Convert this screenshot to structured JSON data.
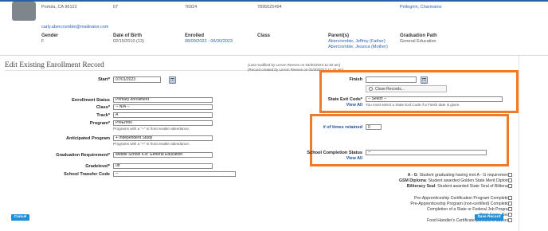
{
  "header": {
    "address": "Portola, CA 96122",
    "grade": "07",
    "school_id": "76924",
    "state_student_id": "7895625494",
    "staff_name": "Pellegrini, Charmaine",
    "email": "carly.abercrombie@mailinator.com",
    "labels": {
      "gender": "Gender",
      "dob": "Date of Birth",
      "enrolled": "Enrolled",
      "class": "Class",
      "parents": "Parent(s)",
      "graduation_path": "Graduation Path"
    },
    "gender": "F",
    "dob": "02/15/2010 (13)",
    "enrolled": "08/09/2022 - 06/30/2023",
    "parents": [
      "Abercrombie, Jeffrey (Father)",
      "Abercrombie, Jessica (Mother)"
    ],
    "graduation_path": "General Education"
  },
  "form": {
    "title": "Edit Existing Enrollment Record",
    "modified_note": "(Last modified by LeAnn Reeves on 03/30/2023 11:20 am)",
    "created_note": "(Record created by LeAnn Reeves on 03/30/2023 11:20 am)",
    "start_label": "Start*",
    "start_value": "07/01/2023",
    "enrollment_status_label": "Enrollment Status",
    "enrollment_status_value": "Primary enrollment",
    "class_label": "Class*",
    "class_value": "-- N/A --",
    "track_label": "Track*",
    "track_value": "A",
    "program_label": "Program*",
    "program_value": "PreEnroll",
    "program_help": "Programs with a \"+\" in front enable attendance.",
    "anticipated_program_label": "Anticipated Program",
    "anticipated_program_value": "+ Independent Study",
    "anticipated_program_help": "Programs with a \"+\" in front enable attendance.",
    "graduation_requirement_label": "Graduation Requirement*",
    "graduation_requirement_value": "Middle School 6-8: General Education",
    "gradelevel_label": "Gradelevel*",
    "gradelevel_value": "08",
    "school_transfer_label": "School Transfer Code",
    "school_transfer_value": "--",
    "finish_label": "Finish",
    "close_records_label": "Close Records...",
    "state_exit_label": "State Exit Code*",
    "state_exit_value": "-- Select --",
    "state_exit_help": "You must select a State Exit Code if a Finish date is given.",
    "view_all": "View All",
    "times_retained_label": "# of times retained",
    "times_retained_value": "0",
    "school_completion_label": "School Completion Status",
    "school_completion_value": "--",
    "view_all_2": "View All"
  },
  "checkboxes": [
    {
      "bold": "A - G",
      "text": ": Student graduating having met A - G requirements"
    },
    {
      "bold": "GSM Diploma",
      "text": ": Student awarded Golden State Merit Diploma"
    },
    {
      "bold": "Biliteracy Seal",
      "text": ": Student awarded State Seal of Biliteracy"
    },
    {
      "bold": "",
      "text": "Pre-Apprenticeship Certification Program Completion"
    },
    {
      "bold": "",
      "text": "Pre-Apprenticeship Program (non-certified) Completion"
    },
    {
      "bold": "",
      "text": "Completion of a State or Federal Job Program"
    },
    {
      "bold": "",
      "text": "Work Force Read"
    },
    {
      "bold": "",
      "text": "Food Handler's Certificate (Limited to Juvenile"
    }
  ],
  "buttons": {
    "cancel": "Cancel",
    "save": "Save Record"
  },
  "colors": {
    "highlight": "#ef7a27",
    "link": "#2a62b8",
    "button": "#1f8fd8"
  }
}
